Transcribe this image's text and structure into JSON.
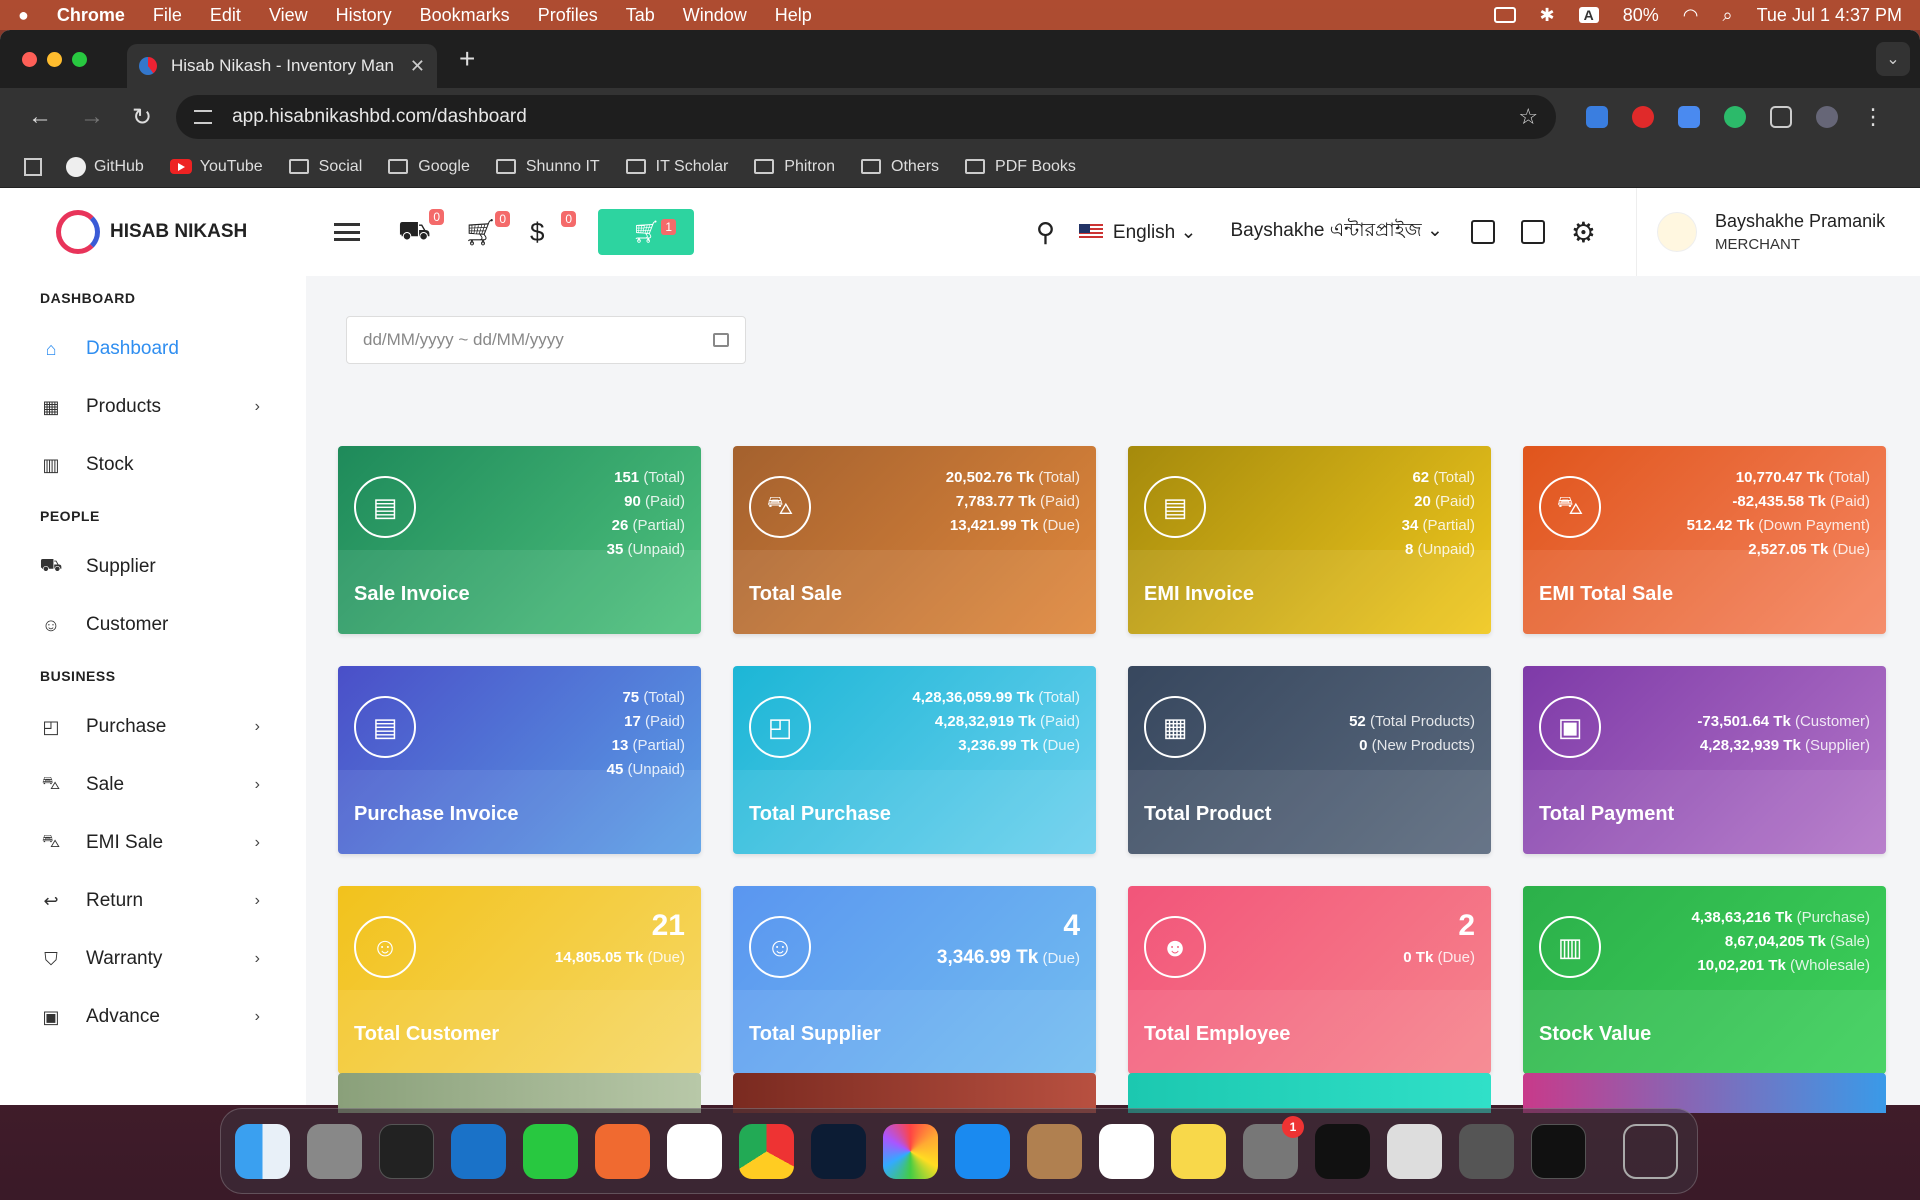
{
  "menubar": {
    "apple": "",
    "app": "Chrome",
    "items": [
      "File",
      "Edit",
      "View",
      "History",
      "Bookmarks",
      "Profiles",
      "Tab",
      "Window",
      "Help"
    ],
    "input_badge": "A",
    "battery": "80%",
    "clock": "Tue Jul 1  4:37 PM"
  },
  "browser": {
    "tab_title": "Hisab Nikash - Inventory Man",
    "tab_close": "✕",
    "new_tab": "+",
    "url": "app.hisabnikashbd.com/dashboard",
    "bookmarks": [
      "GitHub",
      "YouTube",
      "Social",
      "Google",
      "Shunno IT",
      "IT Scholar",
      "Phitron",
      "Others",
      "PDF Books"
    ]
  },
  "app": {
    "logo": "HISAB NIKASH",
    "sidebar": {
      "sections": [
        {
          "title": "DASHBOARD",
          "items": [
            {
              "label": "Dashboard",
              "icon": "home-icon",
              "active": true,
              "chev": false
            }
          ]
        },
        {
          "title": "",
          "items": [
            {
              "label": "Products",
              "icon": "store-icon",
              "chev": true
            },
            {
              "label": "Stock",
              "icon": "bar-chart-icon",
              "chev": false
            }
          ]
        },
        {
          "title": "PEOPLE",
          "items": [
            {
              "label": "Supplier",
              "icon": "truck-icon",
              "chev": false
            },
            {
              "label": "Customer",
              "icon": "users-icon",
              "chev": false
            }
          ]
        },
        {
          "title": "BUSINESS",
          "items": [
            {
              "label": "Purchase",
              "icon": "bag-icon",
              "chev": true
            },
            {
              "label": "Sale",
              "icon": "cart-icon",
              "chev": true
            },
            {
              "label": "EMI Sale",
              "icon": "cart-plus-icon",
              "chev": true
            },
            {
              "label": "Return",
              "icon": "return-icon",
              "chev": true
            },
            {
              "label": "Warranty",
              "icon": "shield-icon",
              "chev": true
            },
            {
              "label": "Advance",
              "icon": "advance-icon",
              "chev": true
            }
          ]
        }
      ]
    },
    "topbar": {
      "badges": [
        "0",
        "0",
        "0"
      ],
      "cart_badge": "1",
      "language": "English",
      "business": "Bayshakhe এন্টারপ্রাইজ",
      "user_name": "Bayshakhe Pramanik",
      "user_role": "MERCHANT"
    },
    "daterange_placeholder": "dd/MM/yyyy ~ dd/MM/yyyy",
    "cards": [
      {
        "title": "Sale Invoice",
        "icon": "document-icon",
        "colors": [
          "#1e8a5a",
          "#4fc27e"
        ],
        "lines": [
          [
            "151",
            "(Total)"
          ],
          [
            "90",
            "(Paid)"
          ],
          [
            "26",
            "(Partial)"
          ],
          [
            "35",
            "(Unpaid)"
          ]
        ]
      },
      {
        "title": "Total Sale",
        "icon": "cart-icon",
        "colors": [
          "#a4612e",
          "#e0883c"
        ],
        "lines": [
          [
            "20,502.76 Tk",
            "(Total)"
          ],
          [
            "7,783.77 Tk",
            "(Paid)"
          ],
          [
            "13,421.99 Tk",
            "(Due)"
          ]
        ]
      },
      {
        "title": "EMI Invoice",
        "icon": "document-plus-icon",
        "colors": [
          "#a58a0c",
          "#f0c81e"
        ],
        "lines": [
          [
            "62",
            "(Total)"
          ],
          [
            "20",
            "(Paid)"
          ],
          [
            "34",
            "(Partial)"
          ],
          [
            "8",
            "(Unpaid)"
          ]
        ]
      },
      {
        "title": "EMI Total Sale",
        "icon": "cart-icon",
        "colors": [
          "#e0551c",
          "#f58560"
        ],
        "lines": [
          [
            "10,770.47 Tk",
            "(Total)"
          ],
          [
            "-82,435.58 Tk",
            "(Paid)"
          ],
          [
            "512.42 Tk",
            "(Down Payment)"
          ],
          [
            "2,527.05 Tk",
            "(Due)"
          ]
        ]
      },
      {
        "title": "Purchase Invoice",
        "icon": "document-icon",
        "colors": [
          "#4a4fc8",
          "#5aa0e6"
        ],
        "lines": [
          [
            "75",
            "(Total)"
          ],
          [
            "17",
            "(Paid)"
          ],
          [
            "13",
            "(Partial)"
          ],
          [
            "45",
            "(Unpaid)"
          ]
        ]
      },
      {
        "title": "Total Purchase",
        "icon": "bag-icon",
        "colors": [
          "#1cb6d6",
          "#6cd0ee"
        ],
        "lines": [
          [
            "4,28,36,059.99 Tk",
            "(Total)"
          ],
          [
            "4,28,32,919 Tk",
            "(Paid)"
          ],
          [
            "3,236.99 Tk",
            "(Due)"
          ]
        ]
      },
      {
        "title": "Total Product",
        "icon": "store-icon",
        "colors": [
          "#37475e",
          "#5b6a7e"
        ],
        "lines": [
          [
            "52",
            "(Total Products)"
          ],
          [
            "0",
            "(New Products)"
          ]
        ]
      },
      {
        "title": "Total Payment",
        "icon": "payment-icon",
        "colors": [
          "#7e3aa8",
          "#b376c8"
        ],
        "lines": [
          [
            "-73,501.64 Tk",
            "(Customer)"
          ],
          [
            "4,28,32,939 Tk",
            "(Supplier)"
          ]
        ]
      },
      {
        "title": "Total Customer",
        "icon": "users-icon",
        "colors": [
          "#f2c21c",
          "#f6d866"
        ],
        "big": "21",
        "lines": [
          [
            "14,805.05 Tk",
            "(Due)"
          ]
        ]
      },
      {
        "title": "Total Supplier",
        "icon": "user-plus-icon",
        "colors": [
          "#5a96f0",
          "#72bdf0"
        ],
        "big": "4",
        "lines": [
          [
            "3,346.99 Tk",
            "(Due)"
          ]
        ]
      },
      {
        "title": "Total Employee",
        "icon": "user-icon",
        "colors": [
          "#f2557a",
          "#f6848c"
        ],
        "big": "2",
        "lines": [
          [
            "0 Tk",
            "(Due)"
          ]
        ]
      },
      {
        "title": "Stock Value",
        "icon": "bar-chart-icon",
        "colors": [
          "#2cb04a",
          "#3cd05a"
        ],
        "lines": [
          [
            "4,38,63,216 Tk",
            "(Purchase)"
          ],
          [
            "8,67,04,205 Tk",
            "(Sale)"
          ],
          [
            "10,02,201 Tk",
            "(Wholesale)"
          ]
        ]
      }
    ]
  },
  "dock": {
    "settings_badge": "1"
  }
}
